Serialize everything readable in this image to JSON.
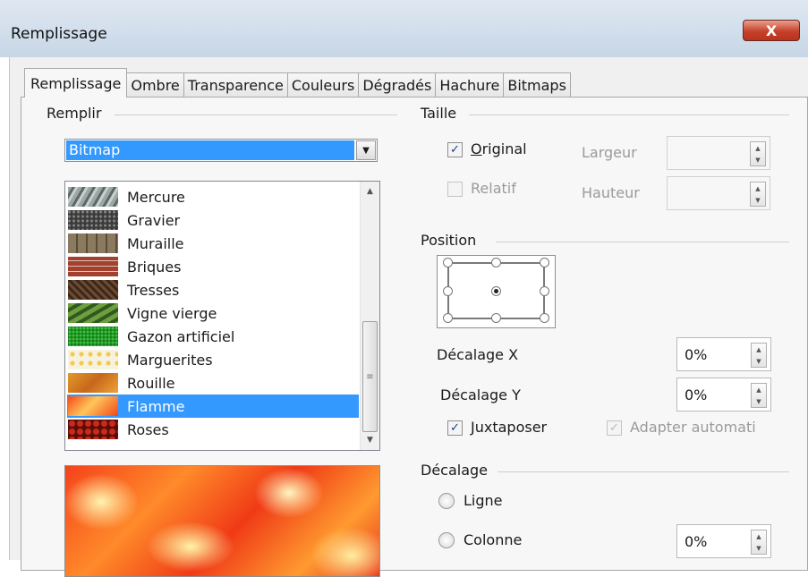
{
  "window": {
    "title": "Remplissage",
    "close_label": "X"
  },
  "tabs": [
    "Remplissage",
    "Ombre",
    "Transparence",
    "Couleurs",
    "Dégradés",
    "Hachure",
    "Bitmaps"
  ],
  "fill": {
    "group_label": "Remplir",
    "type_value": "Bitmap",
    "bitmaps": [
      "Mercure",
      "Gravier",
      "Muraille",
      "Briques",
      "Tresses",
      "Vigne vierge",
      "Gazon artificiel",
      "Marguerites",
      "Rouille",
      "Flamme",
      "Roses"
    ],
    "selected": "Flamme"
  },
  "size": {
    "group_label": "Taille",
    "original_label": "Original",
    "original_checked": true,
    "relative_label": "Relatif",
    "relative_checked": false,
    "width_label": "Largeur",
    "width_value": "",
    "height_label": "Hauteur",
    "height_value": ""
  },
  "position": {
    "group_label": "Position",
    "offset_x_label": "Décalage X",
    "offset_x_value": "0%",
    "offset_y_label": "Décalage Y",
    "offset_y_value": "0%",
    "tile_label": "Juxtaposer",
    "tile_checked": true,
    "autofit_label": "Adapter automati",
    "autofit_checked": true,
    "selected_point": "center"
  },
  "offset": {
    "group_label": "Décalage",
    "row_label": "Ligne",
    "column_label": "Colonne",
    "value": "0%"
  },
  "colors": {
    "selection": "#3399ff",
    "close_button": "#c6412a"
  }
}
